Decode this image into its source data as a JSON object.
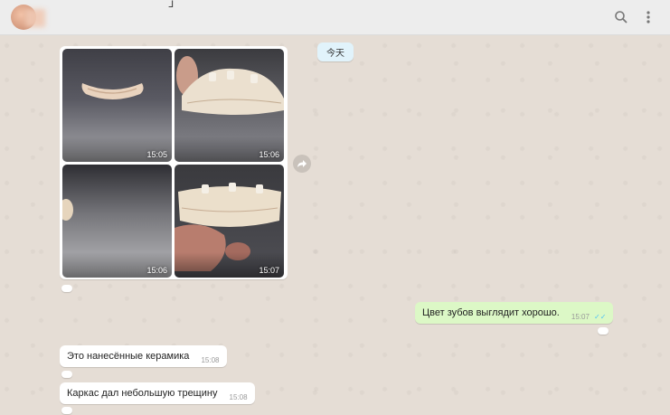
{
  "header": {
    "contact_name": "",
    "search_icon": "search-icon",
    "menu_icon": "more-vert-icon"
  },
  "chat": {
    "date_chip": "今天",
    "photo_grid": {
      "items": [
        {
          "time": "15:05"
        },
        {
          "time": "15:06"
        },
        {
          "time": "15:06"
        },
        {
          "time": "15:07"
        }
      ]
    },
    "messages": [
      {
        "direction": "out",
        "text": "Цвет зубов выглядит хорошо.",
        "time": "15:07",
        "status": "read"
      },
      {
        "direction": "in",
        "text": "Это нанесённые керамика",
        "time": "15:08"
      },
      {
        "direction": "in",
        "text": "Каркас дал небольшую трещину",
        "time": "15:08"
      }
    ]
  },
  "colors": {
    "chat_background": "#e5ddd5",
    "outgoing_bubble": "#dcf8c6",
    "incoming_bubble": "#ffffff",
    "read_tick": "#4fc3f7"
  }
}
